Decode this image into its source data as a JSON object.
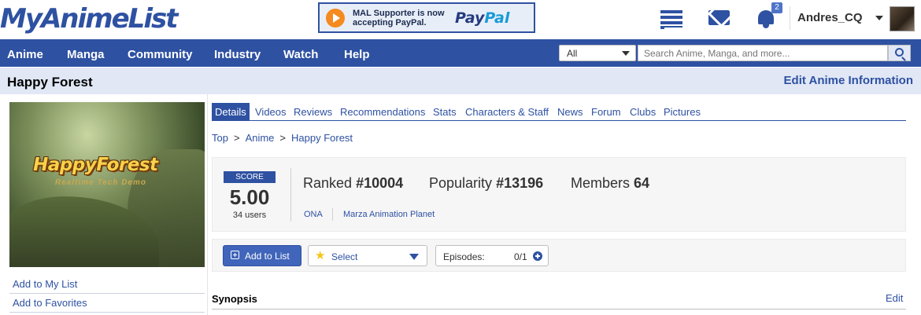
{
  "header": {
    "logo": "MyAnimeList",
    "banner": {
      "text": "MAL Supporter is now accepting PayPal.",
      "brand_a": "Pay",
      "brand_b": "Pal"
    },
    "notifications_count": "2",
    "username": "Andres_CQ"
  },
  "nav": {
    "items": [
      "Anime",
      "Manga",
      "Community",
      "Industry",
      "Watch",
      "Help"
    ],
    "search": {
      "category": "All",
      "placeholder": "Search Anime, Manga, and more..."
    }
  },
  "page": {
    "title": "Happy Forest",
    "edit_info": "Edit Anime Information"
  },
  "cover": {
    "title": "HappyForest",
    "subtitle": "Realtime Tech Demo"
  },
  "sidebar": {
    "links": [
      "Add to My List",
      "Add to Favorites"
    ]
  },
  "tabs": [
    "Details",
    "Videos",
    "Reviews",
    "Recommendations",
    "Stats",
    "Characters & Staff",
    "News",
    "Forum",
    "Clubs",
    "Pictures"
  ],
  "breadcrumb": [
    "Top",
    "Anime",
    "Happy Forest"
  ],
  "breadcrumb_sep": ">",
  "stats": {
    "score_label": "SCORE",
    "score": "5.00",
    "score_users": "34 users",
    "ranked_label": "Ranked",
    "ranked_value": "#10004",
    "popularity_label": "Popularity",
    "popularity_value": "#13196",
    "members_label": "Members",
    "members_value": "64",
    "type": "ONA",
    "studio": "Marza Animation Planet"
  },
  "actions": {
    "add_to_list": "Add to List",
    "status_select": "Select",
    "episodes_label": "Episodes:",
    "episodes_value": "0/1"
  },
  "synopsis": {
    "title": "Synopsis",
    "edit": "Edit"
  },
  "colors": {
    "brand": "#2e51a2",
    "title_bar": "#e1e7f5",
    "box_bg": "#f6f6f6"
  }
}
